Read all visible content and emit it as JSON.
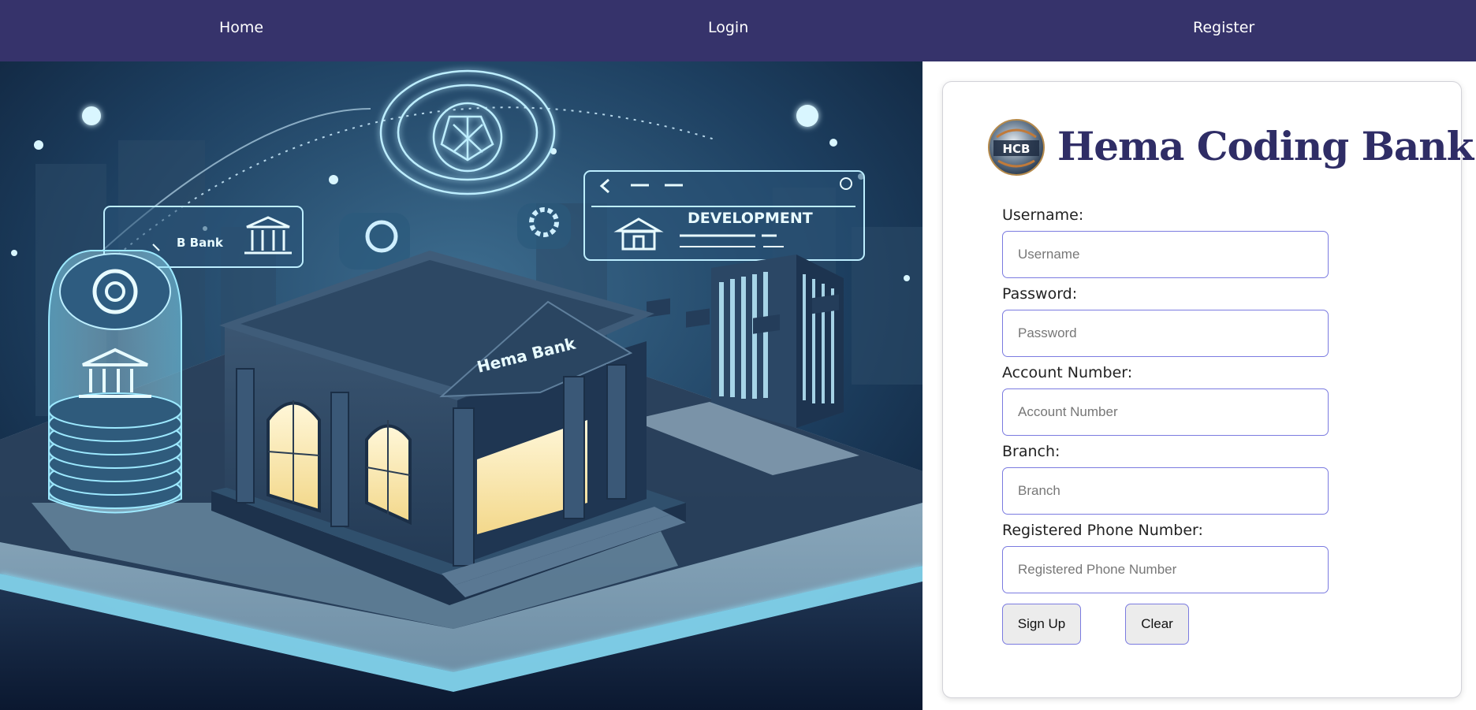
{
  "nav": {
    "home": "Home",
    "login": "Login",
    "register": "Register"
  },
  "hero": {
    "building_sign": "Hema Bank",
    "card_left_text": "B Bank",
    "card_right_text": "DEVELOPMENT"
  },
  "brand": {
    "title": "Hema Coding Bank",
    "logo_text": "HCB"
  },
  "form": {
    "username_label": "Username:",
    "username_placeholder": "Username",
    "password_label": "Password:",
    "password_placeholder": "Password",
    "account_label": "Account Number:",
    "account_placeholder": "Account Number",
    "branch_label": "Branch:",
    "branch_placeholder": "Branch",
    "phone_label": "Registered Phone Number:",
    "phone_placeholder": "Registered Phone Number",
    "signup_label": "Sign Up",
    "clear_label": "Clear"
  },
  "colors": {
    "nav_bg": "#36336b",
    "brand": "#2f2d66",
    "input_border": "#7b7be0",
    "hero_bg": "#0f2540",
    "hero_glow": "#8fe6ff"
  }
}
